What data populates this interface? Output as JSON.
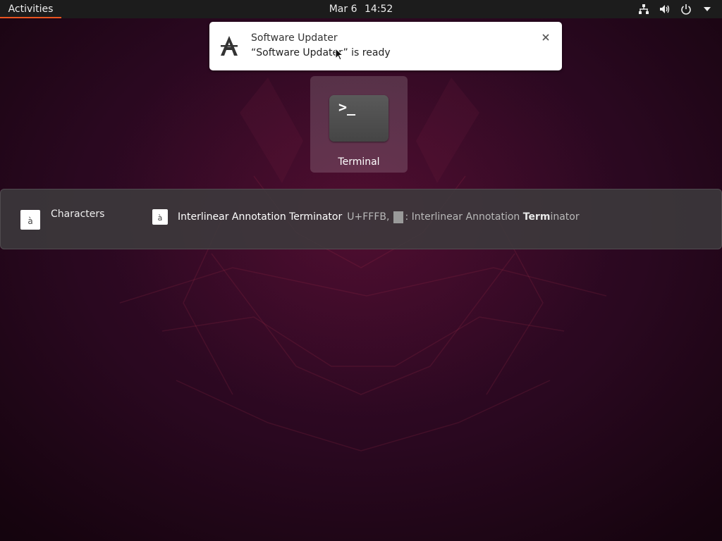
{
  "topbar": {
    "activities_label": "Activities",
    "date": "Mar 6",
    "time": "14:52",
    "tray_icons": [
      "network-icon",
      "volume-icon",
      "power-icon",
      "chevron-down-icon"
    ]
  },
  "notification": {
    "title": "Software Updater",
    "body": "“Software Updater” is ready",
    "icon": "software-updater-icon"
  },
  "apps": [
    {
      "label": "Terminal",
      "icon_text": ">_"
    }
  ],
  "search_results": {
    "provider": "Characters",
    "provider_icon_text": "à",
    "result": {
      "icon_text": "à",
      "name": "Interlinear Annotation Terminator",
      "code": "U+FFFB,",
      "desc_prefix": ": Interlinear Annotation ",
      "desc_highlight": "Term",
      "desc_suffix": "inator"
    }
  },
  "colors": {
    "accent": "#e95420",
    "topbar": "#1c1c1c",
    "notification_bg": "#ffffff"
  }
}
